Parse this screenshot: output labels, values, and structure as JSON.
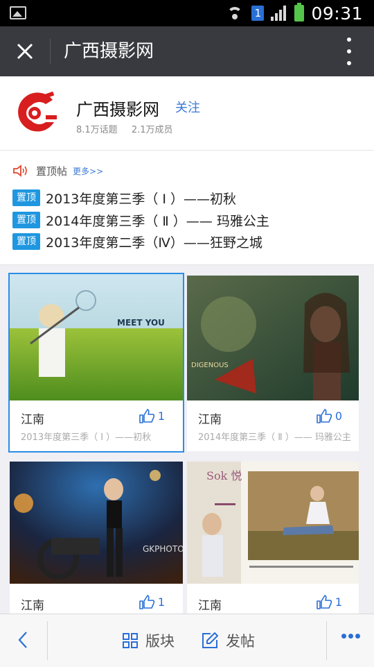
{
  "status_bar": {
    "time": "09:31",
    "sim": "1"
  },
  "title_bar": {
    "title": "广西摄影网"
  },
  "group": {
    "name": "广西摄影网",
    "follow_label": "关注",
    "topics": "8.1万话题",
    "members": "2.1万成员"
  },
  "pinned": {
    "label": "置顶帖",
    "more": "更多>>",
    "badge": "置顶",
    "items": [
      {
        "text": "2013年度第三季（ Ⅰ ）——初秋"
      },
      {
        "text": "2014年度第三季（ Ⅱ ）—— 玛雅公主"
      },
      {
        "text": "2013年度第二季（Ⅳ）——狂野之城"
      }
    ]
  },
  "posts": [
    {
      "author": "江南",
      "likes": "1",
      "subtitle": "2013年度第三季（ Ⅰ ）——初秋",
      "photo_text": "MEET YOU"
    },
    {
      "author": "江南",
      "likes": "0",
      "subtitle": "2014年度第三季（ Ⅱ ）—— 玛雅公主",
      "photo_text": "DIGENOUS"
    },
    {
      "author": "江南",
      "likes": "1",
      "subtitle": "",
      "photo_text": "GKPHOTO"
    },
    {
      "author": "江南",
      "likes": "1",
      "subtitle": "",
      "photo_text": "Sok 悦"
    }
  ],
  "bottom_bar": {
    "sections_label": "版块",
    "post_label": "发帖"
  },
  "colors": {
    "accent": "#3b79d9",
    "badge": "#1f97e0",
    "title_bar": "#393a3f"
  }
}
